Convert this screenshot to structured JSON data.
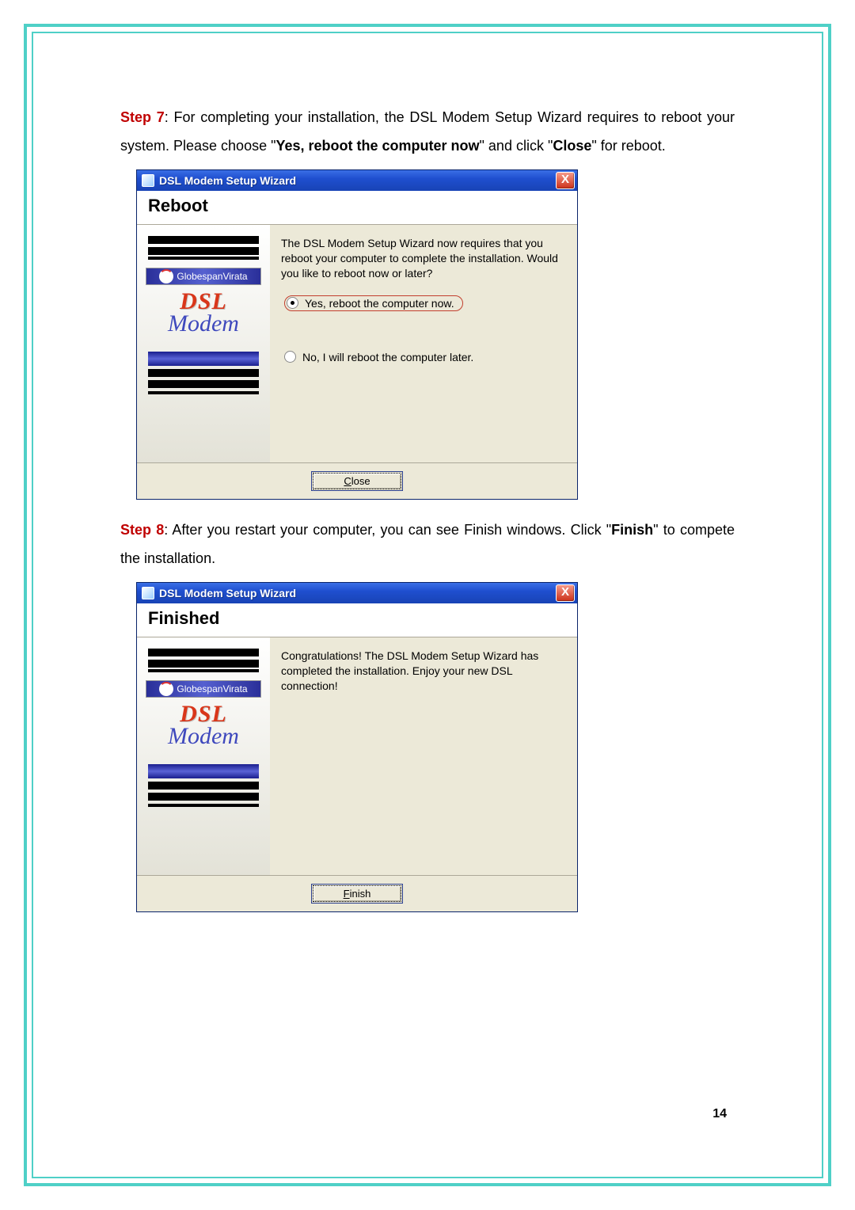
{
  "step7": {
    "label": "Step 7",
    "text_a": ": For completing your installation, the DSL Modem Setup Wizard requires to reboot your system. Please choose \"",
    "bold_a": "Yes, reboot the computer now",
    "text_b": "\" and click \"",
    "bold_b": "Close",
    "text_c": "\" for reboot."
  },
  "step8": {
    "label": "Step 8",
    "text_a": ": After you restart your computer, you can see Finish windows. Click \"",
    "bold_a": "Finish",
    "text_b": "\" to compete the installation."
  },
  "window_common": {
    "title": "DSL Modem Setup Wizard",
    "brand": "GlobespanVirata",
    "logo_line1": "DSL",
    "logo_line2": "Modem",
    "close_x": "X"
  },
  "reboot_window": {
    "header": "Reboot",
    "message": "The DSL Modem Setup Wizard now requires that you reboot your computer to complete the installation.  Would you like to reboot now or later?",
    "option_yes": "Yes, reboot the computer now.",
    "option_no": "No, I will reboot the computer later.",
    "button_prefix": "C",
    "button_rest": "lose"
  },
  "finished_window": {
    "header": "Finished",
    "message": "Congratulations!  The DSL Modem Setup Wizard has completed the installation.  Enjoy your new DSL connection!",
    "button_prefix": "F",
    "button_rest": "inish"
  },
  "page_number": "14"
}
